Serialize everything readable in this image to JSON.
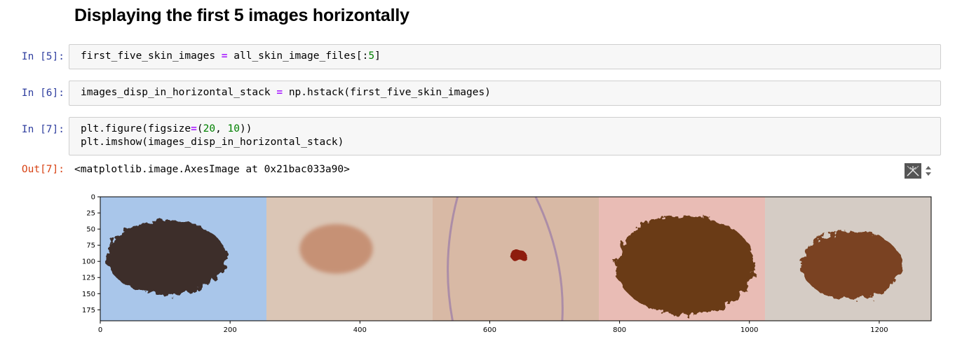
{
  "heading": "Displaying the first 5 images horizontally",
  "cells": [
    {
      "prompt": "In [5]:",
      "lines": [
        [
          {
            "t": "first_five_skin_images "
          },
          {
            "t": "=",
            "c": "op"
          },
          {
            "t": " all_skin_image_files[:"
          },
          {
            "t": "5",
            "c": "num"
          },
          {
            "t": "]"
          }
        ]
      ]
    },
    {
      "prompt": "In [6]:",
      "lines": [
        [
          {
            "t": "images_disp_in_horizontal_stack "
          },
          {
            "t": "=",
            "c": "op"
          },
          {
            "t": " np.hstack(first_five_skin_images)"
          }
        ]
      ]
    },
    {
      "prompt": "In [7]:",
      "lines": [
        [
          {
            "t": "plt.figure(figsize"
          },
          {
            "t": "=",
            "c": "op"
          },
          {
            "t": "("
          },
          {
            "t": "20",
            "c": "num"
          },
          {
            "t": ", "
          },
          {
            "t": "10",
            "c": "num"
          },
          {
            "t": "))"
          }
        ],
        [
          {
            "t": "plt.imshow(images_disp_in_horizontal_stack)"
          }
        ]
      ]
    }
  ],
  "output": {
    "prompt": "Out[7]:",
    "text": "<matplotlib.image.AxesImage at 0x21bac033a90>"
  },
  "chart_data": {
    "type": "image",
    "title": "",
    "xlabel": "",
    "ylabel": "",
    "xlim": [
      0,
      1280
    ],
    "ylim": [
      192,
      0
    ],
    "xticks": [
      0,
      200,
      400,
      600,
      800,
      1000,
      1200
    ],
    "yticks": [
      0,
      25,
      50,
      75,
      100,
      125,
      150,
      175
    ],
    "panels": [
      {
        "x_range": [
          0,
          256
        ],
        "background": "#a9c6ea",
        "lesion_color": "#3d2f2c"
      },
      {
        "x_range": [
          256,
          512
        ],
        "background": "#dbc6b6",
        "lesion_color": "#c08060"
      },
      {
        "x_range": [
          512,
          768
        ],
        "background": "#d8b9a5",
        "lesion_color": "#8e1a10"
      },
      {
        "x_range": [
          768,
          1024
        ],
        "background": "#e9bcb5",
        "lesion_color": "#6a3a18"
      },
      {
        "x_range": [
          1024,
          1280
        ],
        "background": "#d5ccc5",
        "lesion_color": "#7a4320"
      }
    ]
  }
}
